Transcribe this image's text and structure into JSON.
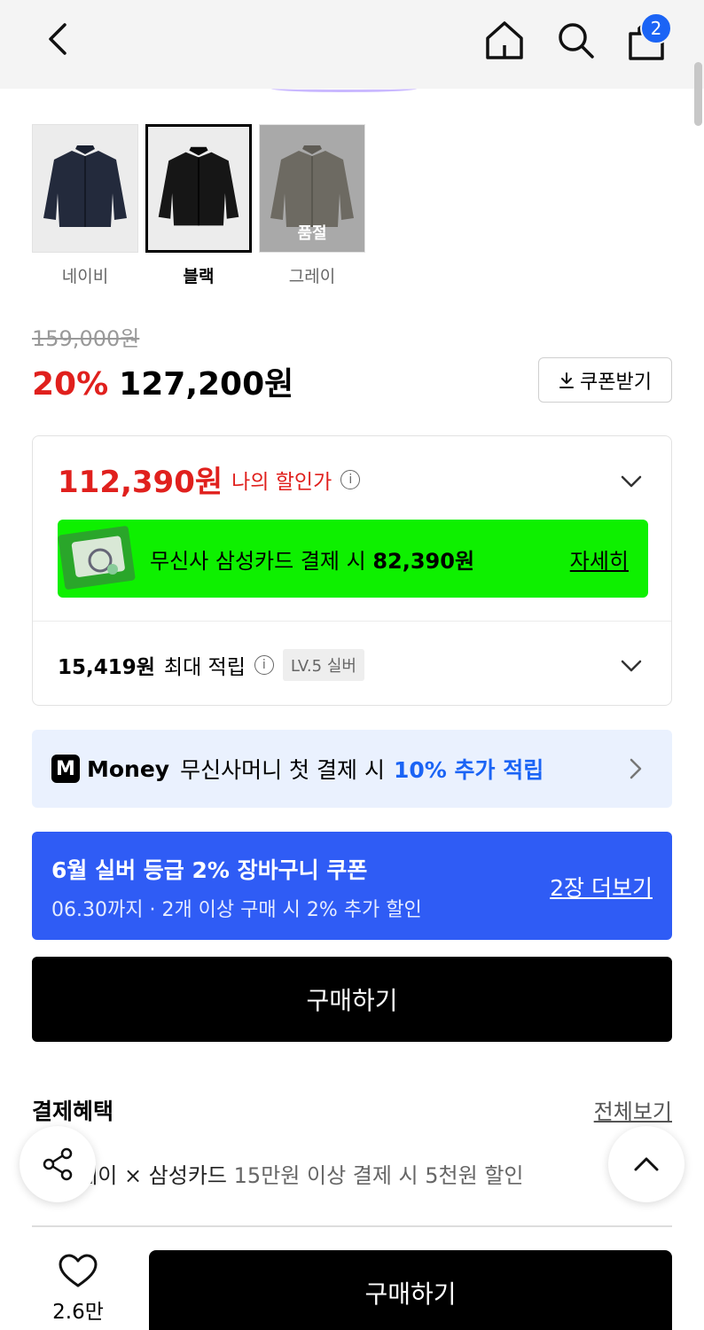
{
  "header": {
    "cart_count": "2"
  },
  "colors": {
    "options": [
      {
        "label": "네이비",
        "state": "normal",
        "jacket_color": "#232a3c"
      },
      {
        "label": "블랙",
        "state": "selected",
        "jacket_color": "#161616"
      },
      {
        "label": "그레이",
        "state": "soldout",
        "jacket_color": "#7a766c",
        "badge": "품절"
      }
    ]
  },
  "price": {
    "original": "159,000원",
    "discount_rate": "20%",
    "final": "127,200원",
    "coupon_button": "쿠폰받기"
  },
  "benefit": {
    "my_price": "112,390원",
    "my_price_label": "나의 할인가",
    "card_text": "무신사 삼성카드 결제 시",
    "card_price": "82,390원",
    "card_detail": "자세히",
    "points_amount": "15,419원",
    "points_label": "최대 적립",
    "level_badge": "LV.5 실버"
  },
  "money_banner": {
    "logo": "M",
    "brand": "Money",
    "text": "무신사머니 첫 결제 시",
    "highlight": "10% 추가 적립"
  },
  "coupon_banner": {
    "title": "6월 실버 등급 2% 장바구니 쿠폰",
    "subtitle": "06.30까지 · 2개 이상 구매 시 2% 추가 할인",
    "more": "2장 더보기"
  },
  "buy_label": "구매하기",
  "payment_benefits": {
    "title": "결제혜택",
    "view_all": "전체보기",
    "item_prefix": "토스페이 × 삼성카드",
    "item_text": "15만원 이상 결제 시 5천원 할인"
  },
  "bottom": {
    "like_count": "2.6만",
    "buy_label": "구매하기"
  },
  "theme": {
    "red": "#e0201d",
    "blue": "#2f5cf5",
    "green": "#0ef000"
  }
}
